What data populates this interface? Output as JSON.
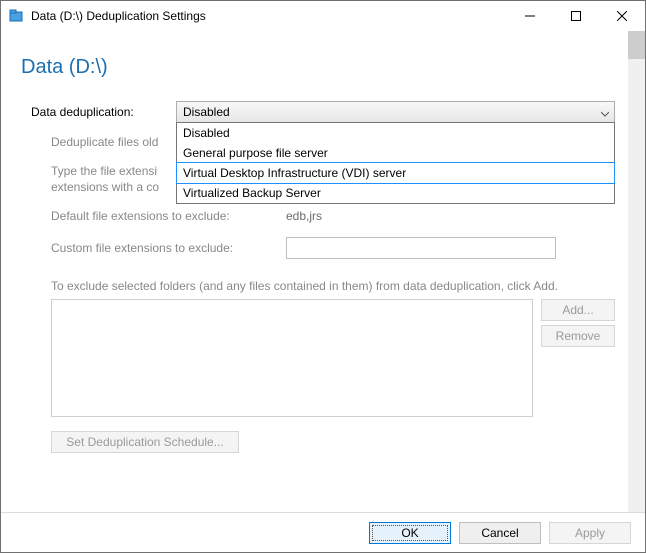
{
  "window": {
    "title": "Data (D:\\) Deduplication Settings"
  },
  "heading": "Data (D:\\)",
  "labels": {
    "dedup": "Data deduplication:",
    "dedup_files_older": "Deduplicate files old",
    "type_ext_line1": "Type the file extensi",
    "type_ext_line2": "extensions with a co",
    "default_ext_label": "Default file extensions to exclude:",
    "default_ext_value": "edb,jrs",
    "custom_ext_label": "Custom file extensions to exclude:",
    "exclude_instruction": "To exclude selected folders (and any files contained in them) from data deduplication, click Add."
  },
  "dropdown": {
    "selected": "Disabled",
    "options": [
      "Disabled",
      "General purpose file server",
      "Virtual Desktop Infrastructure (VDI) server",
      "Virtualized Backup Server"
    ]
  },
  "custom_ext_value": "",
  "buttons": {
    "add": "Add...",
    "remove": "Remove",
    "schedule": "Set Deduplication Schedule...",
    "ok": "OK",
    "cancel": "Cancel",
    "apply": "Apply"
  }
}
